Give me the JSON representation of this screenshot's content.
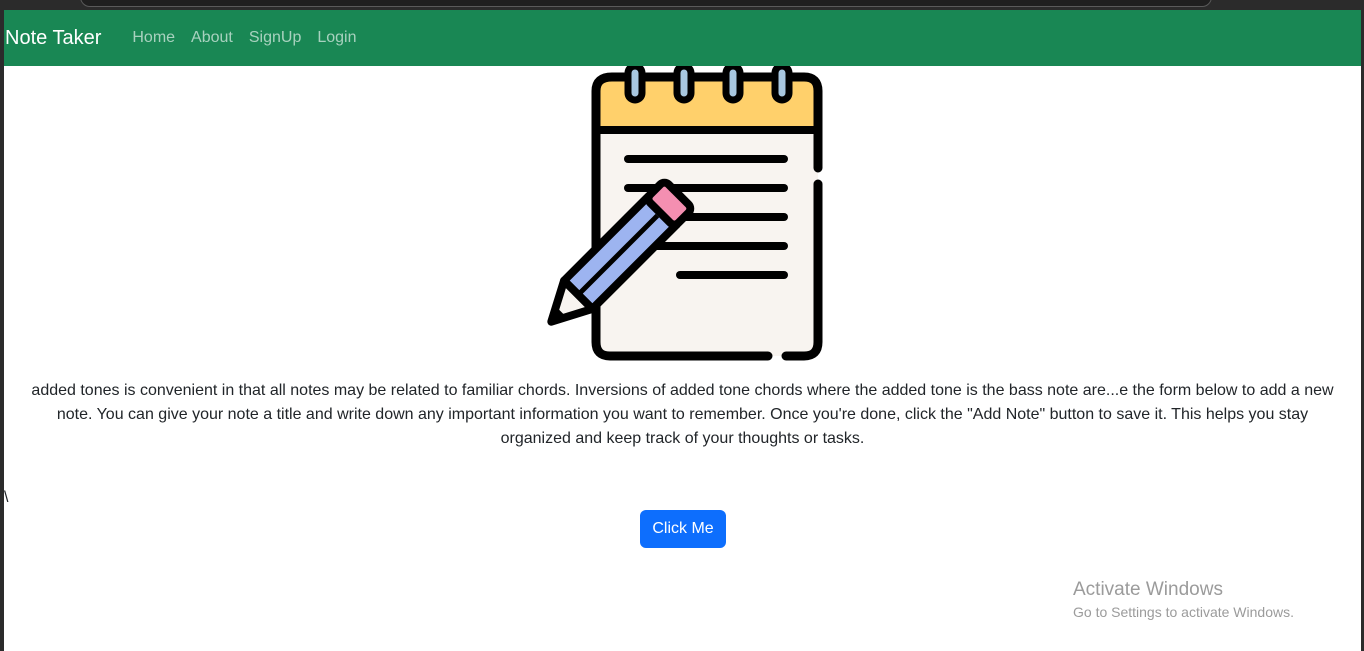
{
  "navbar": {
    "brand": "Note Taker",
    "links": [
      "Home",
      "About",
      "SignUp",
      "Login"
    ],
    "background": "#198754"
  },
  "main": {
    "image_icon": "notepad-with-pencil",
    "description": "added tones is convenient in that all notes may be related to familiar chords. Inversions of added tone chords where the added tone is the bass note are...e the form below to add a new note. You can give your note a title and write down any important information you want to remember. Once you're done, click the \"Add Note\" button to save it. This helps you stay organized and keep track of your thoughts or tasks.",
    "stray_text": "\\",
    "button_label": "Click Me",
    "button_color": "#0d6efd"
  },
  "watermark": {
    "title": "Activate Windows",
    "subtitle": "Go to Settings to activate Windows."
  }
}
